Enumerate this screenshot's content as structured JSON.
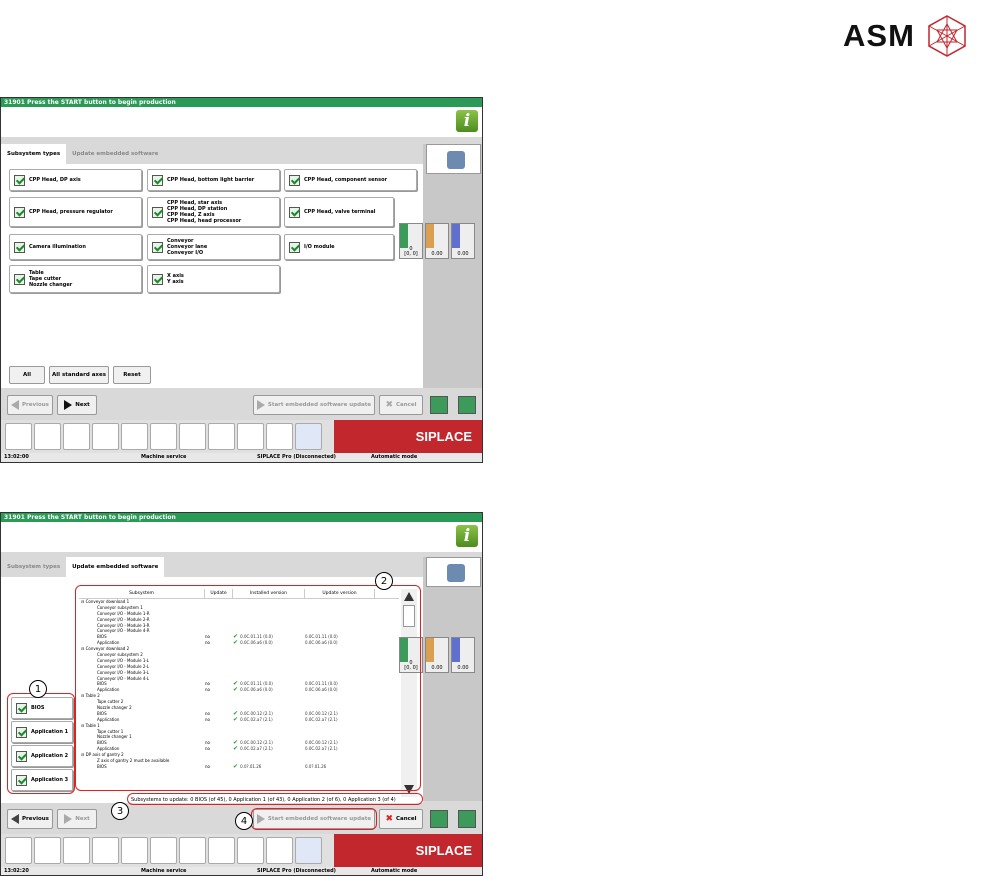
{
  "logo": {
    "text": "ASM"
  },
  "screen1": {
    "title_bar": "31901 Press the START button to begin production",
    "info_label": "i",
    "tabs": [
      {
        "label": "Subsystem types"
      },
      {
        "label": "Update embedded software"
      }
    ],
    "checkboxes": [
      {
        "label": "CPP Head, DP axis"
      },
      {
        "label": "CPP Head, bottom light barrier"
      },
      {
        "label": "CPP Head, component sensor"
      },
      {
        "label": "CPP Head, pressure regulator"
      },
      {
        "label": "CPP Head, star axis\nCPP Head, DP station\nCPP Head, Z axis\nCPP Head, head processor"
      },
      {
        "label": "CPP Head, valve terminal"
      },
      {
        "label": "Camera illumination"
      },
      {
        "label": "Conveyor\nConveyor lane\nConveyor I/O"
      },
      {
        "label": "I/O module"
      },
      {
        "label": "Table\nTape cutter\nNozzle changer"
      },
      {
        "label": "X axis\nY axis"
      }
    ],
    "buttons": {
      "all": "All",
      "all_standard": "All standard axes",
      "reset": "Reset"
    },
    "nav": {
      "previous": "Previous",
      "next": "Next",
      "start_update": "Start embedded software update",
      "cancel": "Cancel"
    },
    "gauges": [
      {
        "value": "0",
        "sub": "[0, 0]"
      },
      {
        "value": "0.00"
      },
      {
        "value": "0.00"
      }
    ],
    "brand": "SIPLACE",
    "status": {
      "time": "13:02:00",
      "service": "Machine service",
      "pro": "SIPLACE Pro (Disconnected)",
      "mode": "Automatic mode"
    }
  },
  "screen2": {
    "title_bar": "31901 Press the START button to begin production",
    "info_label": "i",
    "tabs": [
      {
        "label": "Subsystem types"
      },
      {
        "label": "Update embedded software"
      }
    ],
    "side_checkboxes": [
      {
        "label": "BIOS"
      },
      {
        "label": "Application 1"
      },
      {
        "label": "Application 2"
      },
      {
        "label": "Application 3"
      }
    ],
    "table_headers": [
      "Subsystem",
      "Update",
      "Installed version",
      "Update version"
    ],
    "rows": [
      {
        "name": "Conveyor download 1",
        "update": "",
        "installed": "",
        "target": "",
        "indent": 0
      },
      {
        "name": "Conveyor subsystem 1",
        "update": "",
        "installed": "",
        "target": "",
        "indent": 1
      },
      {
        "name": "Conveyor I/O - Module 1-R",
        "update": "",
        "installed": "",
        "target": "",
        "indent": 1
      },
      {
        "name": "Conveyor I/O - Module 2-R",
        "update": "",
        "installed": "",
        "target": "",
        "indent": 1
      },
      {
        "name": "Conveyor I/O - Module 3-R",
        "update": "",
        "installed": "",
        "target": "",
        "indent": 1
      },
      {
        "name": "Conveyor I/O - Module 4-R",
        "update": "",
        "installed": "",
        "target": "",
        "indent": 1
      },
      {
        "name": "BIOS",
        "update": "no",
        "installed": "0.0C.01.11 (0.0)",
        "target": "0.0C.01.11 (0.0)",
        "indent": 1
      },
      {
        "name": "Application",
        "update": "no",
        "installed": "0.0C.06.a6 (0.0)",
        "target": "0.0C.06.a6 (0.0)",
        "indent": 1
      },
      {
        "name": "Conveyor download 2",
        "update": "",
        "installed": "",
        "target": "",
        "indent": 0
      },
      {
        "name": "Conveyor subsystem 2",
        "update": "",
        "installed": "",
        "target": "",
        "indent": 1
      },
      {
        "name": "Conveyor I/O - Module 1-L",
        "update": "",
        "installed": "",
        "target": "",
        "indent": 1
      },
      {
        "name": "Conveyor I/O - Module 2-L",
        "update": "",
        "installed": "",
        "target": "",
        "indent": 1
      },
      {
        "name": "Conveyor I/O - Module 3-L",
        "update": "",
        "installed": "",
        "target": "",
        "indent": 1
      },
      {
        "name": "Conveyor I/O - Module 4-L",
        "update": "",
        "installed": "",
        "target": "",
        "indent": 1
      },
      {
        "name": "BIOS",
        "update": "no",
        "installed": "0.0C.01.11 (0.0)",
        "target": "0.0C.01.11 (0.0)",
        "indent": 1
      },
      {
        "name": "Application",
        "update": "no",
        "installed": "0.0C.06.a6 (0.0)",
        "target": "0.0C.06.a6 (0.0)",
        "indent": 1
      },
      {
        "name": "Table 2",
        "update": "",
        "installed": "",
        "target": "",
        "indent": 0
      },
      {
        "name": "Tape cutter 2",
        "update": "",
        "installed": "",
        "target": "",
        "indent": 1
      },
      {
        "name": "Nozzle changer 2",
        "update": "",
        "installed": "",
        "target": "",
        "indent": 1
      },
      {
        "name": "BIOS",
        "update": "no",
        "installed": "0.0C.00.12 (2.1)",
        "target": "0.0C.00.12 (2.1)",
        "indent": 1
      },
      {
        "name": "Application",
        "update": "no",
        "installed": "0.0C.02.a7 (2.1)",
        "target": "0.0C.02.a7 (2.1)",
        "indent": 1
      },
      {
        "name": "Table 1",
        "update": "",
        "installed": "",
        "target": "",
        "indent": 0
      },
      {
        "name": "Tape cutter 1",
        "update": "",
        "installed": "",
        "target": "",
        "indent": 1
      },
      {
        "name": "Nozzle changer 1",
        "update": "",
        "installed": "",
        "target": "",
        "indent": 1
      },
      {
        "name": "BIOS",
        "update": "no",
        "installed": "0.0C.00.12 (2.1)",
        "target": "0.0C.00.12 (2.1)",
        "indent": 1
      },
      {
        "name": "Application",
        "update": "no",
        "installed": "0.0C.02.a7 (2.1)",
        "target": "0.0C.02.a7 (2.1)",
        "indent": 1
      },
      {
        "name": "DP axis of gantry 2",
        "update": "",
        "installed": "",
        "target": "",
        "indent": 0
      },
      {
        "name": "Z axis of gantry 2 must be available",
        "update": "",
        "installed": "",
        "target": "",
        "indent": 1
      },
      {
        "name": "BIOS",
        "update": "no",
        "installed": "0.0?.01.26",
        "target": "0.0?.01.26",
        "indent": 1
      }
    ],
    "summary": "Subsystems to update: 0 BIOS (of 45), 0 Application 1 (of 43), 0 Application 2 (of 6), 0 Application 3 (of 4)",
    "callouts": [
      "1",
      "2",
      "3",
      "4"
    ],
    "nav": {
      "previous": "Previous",
      "next": "Next",
      "start_update": "Start embedded software update",
      "cancel": "Cancel"
    },
    "gauges": [
      {
        "value": "0",
        "sub": "[0, 0]"
      },
      {
        "value": "0.00"
      },
      {
        "value": "0.00"
      }
    ],
    "brand": "SIPLACE",
    "status": {
      "time": "13:02:20",
      "service": "Machine service",
      "pro": "SIPLACE Pro (Disconnected)",
      "mode": "Automatic mode"
    }
  }
}
